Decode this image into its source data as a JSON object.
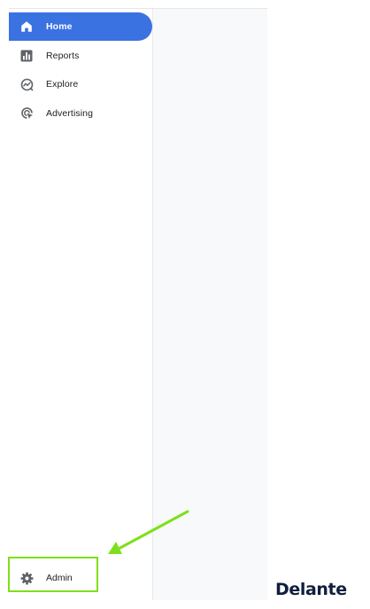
{
  "sidebar": {
    "items": [
      {
        "label": "Home",
        "icon": "home-icon",
        "active": true
      },
      {
        "label": "Reports",
        "icon": "reports-icon",
        "active": false
      },
      {
        "label": "Explore",
        "icon": "explore-icon",
        "active": false
      },
      {
        "label": "Advertising",
        "icon": "advertising-icon",
        "active": false
      }
    ],
    "admin": {
      "label": "Admin",
      "icon": "gear-icon"
    }
  },
  "annotation": {
    "highlight_color": "#7ee01a",
    "highlighted_item": "Admin"
  },
  "logo": {
    "text": "Delante"
  },
  "colors": {
    "accent": "#3a72e2",
    "text": "#202124",
    "icon": "#5f6368",
    "content_background": "#f8f9fa",
    "logo": "#0f1f3c"
  }
}
